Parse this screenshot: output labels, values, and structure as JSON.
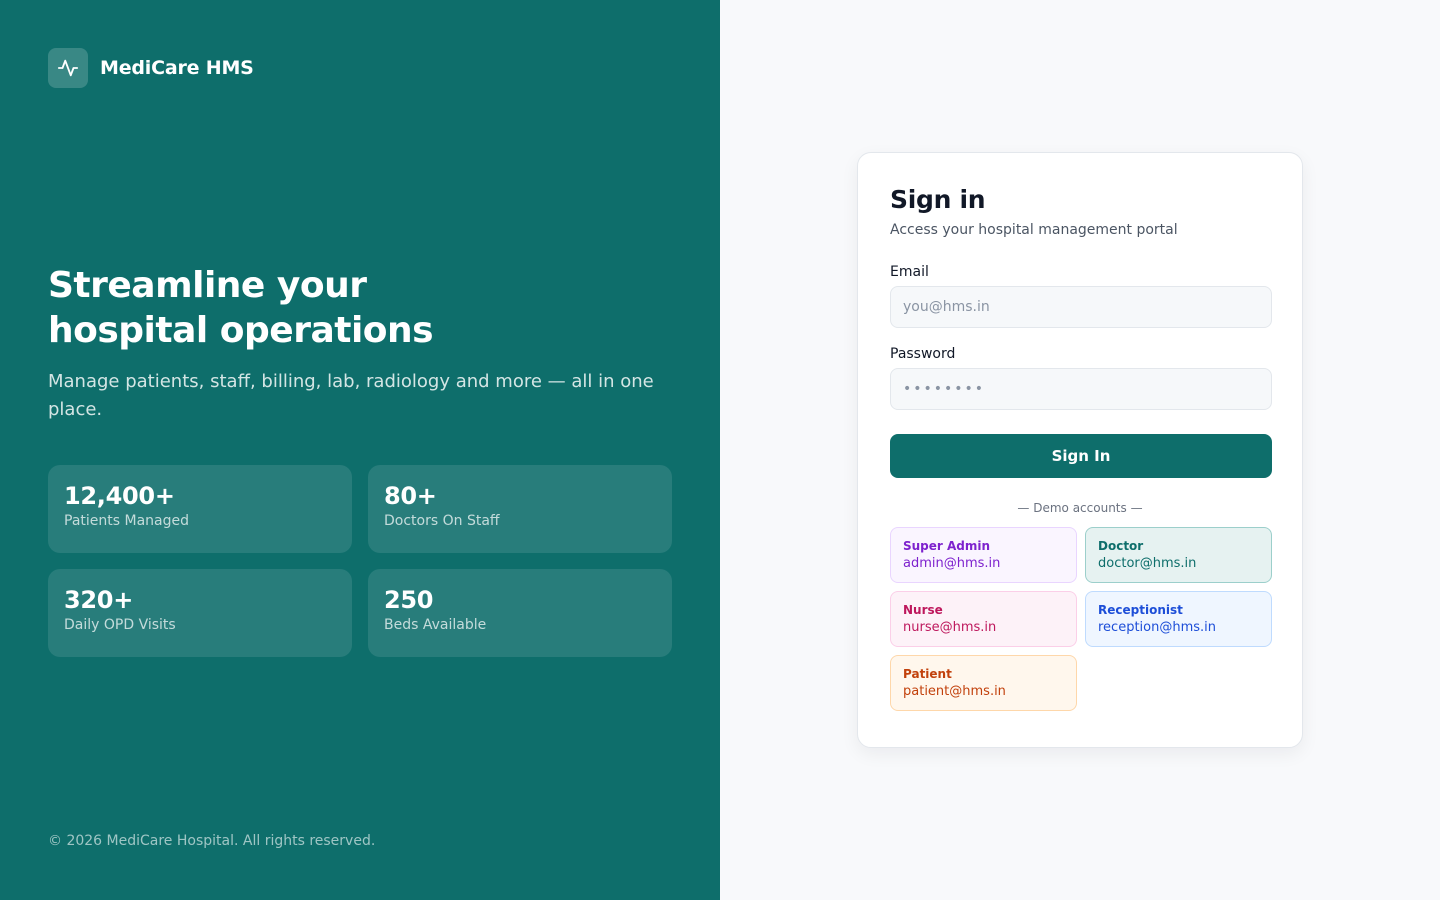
{
  "brand": {
    "name": "MediCare HMS",
    "logo_icon": "pulse-icon"
  },
  "hero": {
    "title_line1": "Streamline your",
    "title_line2": "hospital operations",
    "subtitle": "Manage patients, staff, billing, lab, radiology and more — all in one place."
  },
  "stats": [
    {
      "value": "12,400+",
      "label": "Patients Managed"
    },
    {
      "value": "80+",
      "label": "Doctors On Staff"
    },
    {
      "value": "320+",
      "label": "Daily OPD Visits"
    },
    {
      "value": "250",
      "label": "Beds Available"
    }
  ],
  "footer": {
    "copyright": "© 2026 MediCare Hospital. All rights reserved."
  },
  "signin": {
    "title": "Sign in",
    "subtitle": "Access your hospital management portal",
    "email_label": "Email",
    "email_placeholder": "you@hms.in",
    "email_value": "",
    "password_label": "Password",
    "password_placeholder": "••••••••",
    "password_value": "",
    "button_label": "Sign In",
    "demo_heading": "— Demo accounts —",
    "demo_accounts": [
      {
        "role": "Super Admin",
        "email": "admin@hms.in"
      },
      {
        "role": "Doctor",
        "email": "doctor@hms.in"
      },
      {
        "role": "Nurse",
        "email": "nurse@hms.in"
      },
      {
        "role": "Receptionist",
        "email": "reception@hms.in"
      },
      {
        "role": "Patient",
        "email": "patient@hms.in"
      }
    ]
  },
  "colors": {
    "brand": "#0e6e6b",
    "admin": "#7e22ce",
    "doctor": "#0e6e6b",
    "nurse": "#be185d",
    "reception": "#1d4ed8",
    "patient": "#c2410c"
  }
}
